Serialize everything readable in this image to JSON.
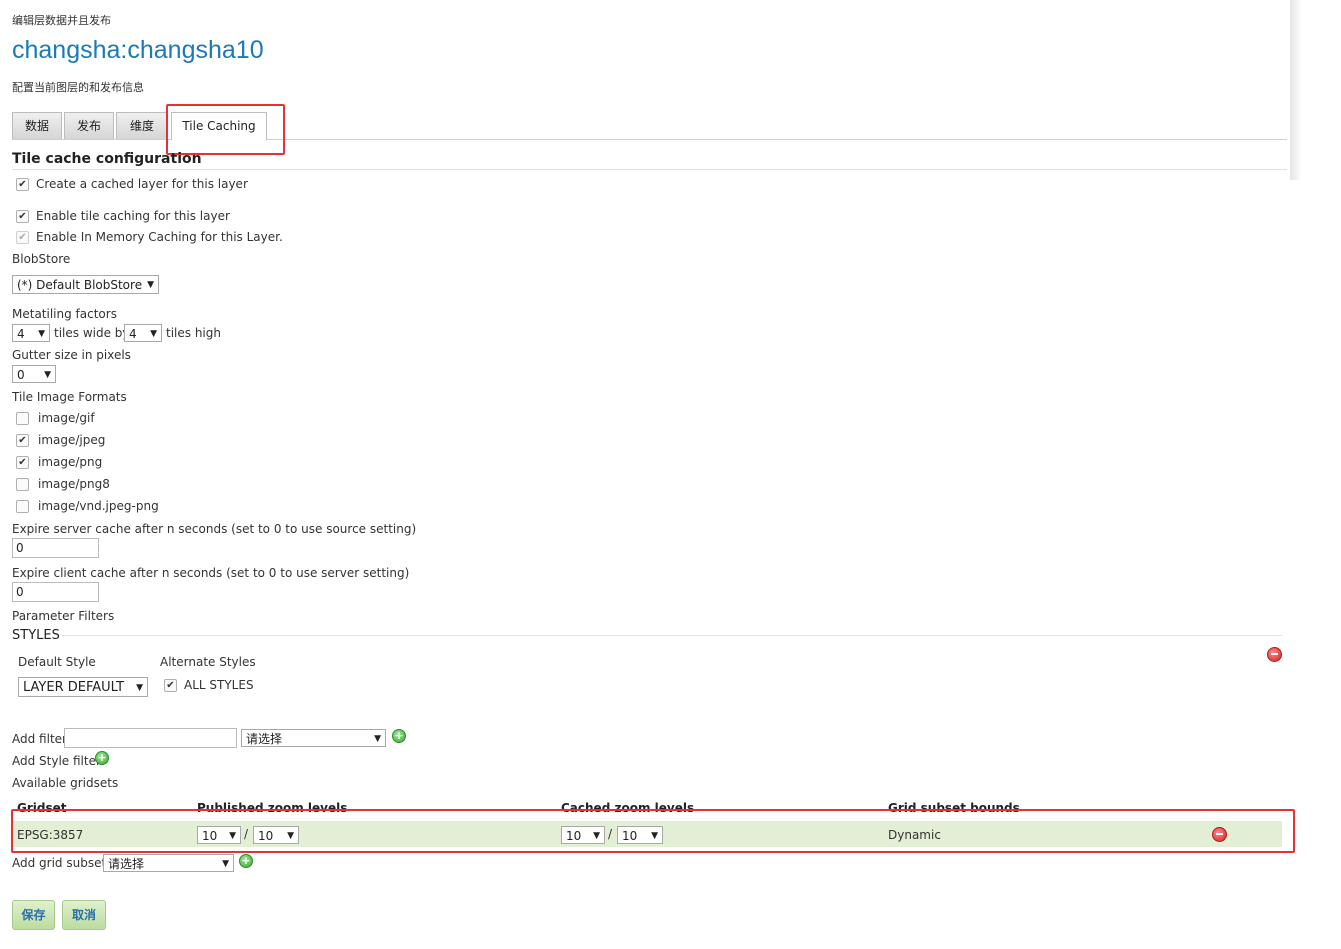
{
  "breadcrumb": "编辑层数据并且发布",
  "page_title": "changsha:changsha10",
  "page_description": "配置当前图层的和发布信息",
  "tabs": [
    "数据",
    "发布",
    "维度",
    "Tile Caching"
  ],
  "active_tab": "Tile Caching",
  "section_title": "Tile cache configuration",
  "create_cached_layer": {
    "label": "Create a cached layer for this layer",
    "checked": true
  },
  "enable_tile_caching": {
    "label": "Enable tile caching for this layer",
    "checked": true
  },
  "enable_memory_caching": {
    "label": "Enable In Memory Caching for this Layer.",
    "checked": true
  },
  "blobstore": {
    "label": "BlobStore",
    "value": "(*) Default BlobStore"
  },
  "metatiling": {
    "label": "Metatiling factors",
    "wide": "4",
    "wide_text": "tiles wide by",
    "high": "4",
    "high_text": "tiles high"
  },
  "gutter": {
    "label": "Gutter size in pixels",
    "value": "0"
  },
  "formats": {
    "label": "Tile Image Formats",
    "items": [
      {
        "name": "image/gif",
        "checked": false
      },
      {
        "name": "image/jpeg",
        "checked": true
      },
      {
        "name": "image/png",
        "checked": true
      },
      {
        "name": "image/png8",
        "checked": false
      },
      {
        "name": "image/vnd.jpeg-png",
        "checked": false
      }
    ]
  },
  "expire_server": {
    "label": "Expire server cache after n seconds (set to 0 to use source setting)",
    "value": "0"
  },
  "expire_client": {
    "label": "Expire client cache after n seconds (set to 0 to use server setting)",
    "value": "0"
  },
  "parameter_filters": {
    "label": "Parameter Filters",
    "styles_legend": "STYLES",
    "default_style_label": "Default Style",
    "default_style_value": "LAYER DEFAULT",
    "alternate_styles_label": "Alternate Styles",
    "all_styles_label": "ALL STYLES",
    "all_styles_checked": true
  },
  "add_filter": {
    "label": "Add filter",
    "select_placeholder": "请选择"
  },
  "add_style_filter": "Add Style filter",
  "gridsets": {
    "label": "Available gridsets",
    "headers": [
      "Gridset",
      "Published zoom levels",
      "Cached zoom levels",
      "Grid subset bounds"
    ],
    "rows": [
      {
        "name": "EPSG:3857",
        "pub_min": "10",
        "pub_max": "10",
        "cache_min": "10",
        "cache_max": "10",
        "bounds": "Dynamic"
      }
    ],
    "separator": "/"
  },
  "add_grid_subset": {
    "label": "Add grid subset:",
    "select_placeholder": "请选择"
  },
  "buttons": {
    "save": "保存",
    "cancel": "取消"
  },
  "colors": {
    "title": "#1a7ab8",
    "highlight_box": "#e53333",
    "row_bg": "#e3efd4",
    "button_bg": "#c9e4b0"
  }
}
